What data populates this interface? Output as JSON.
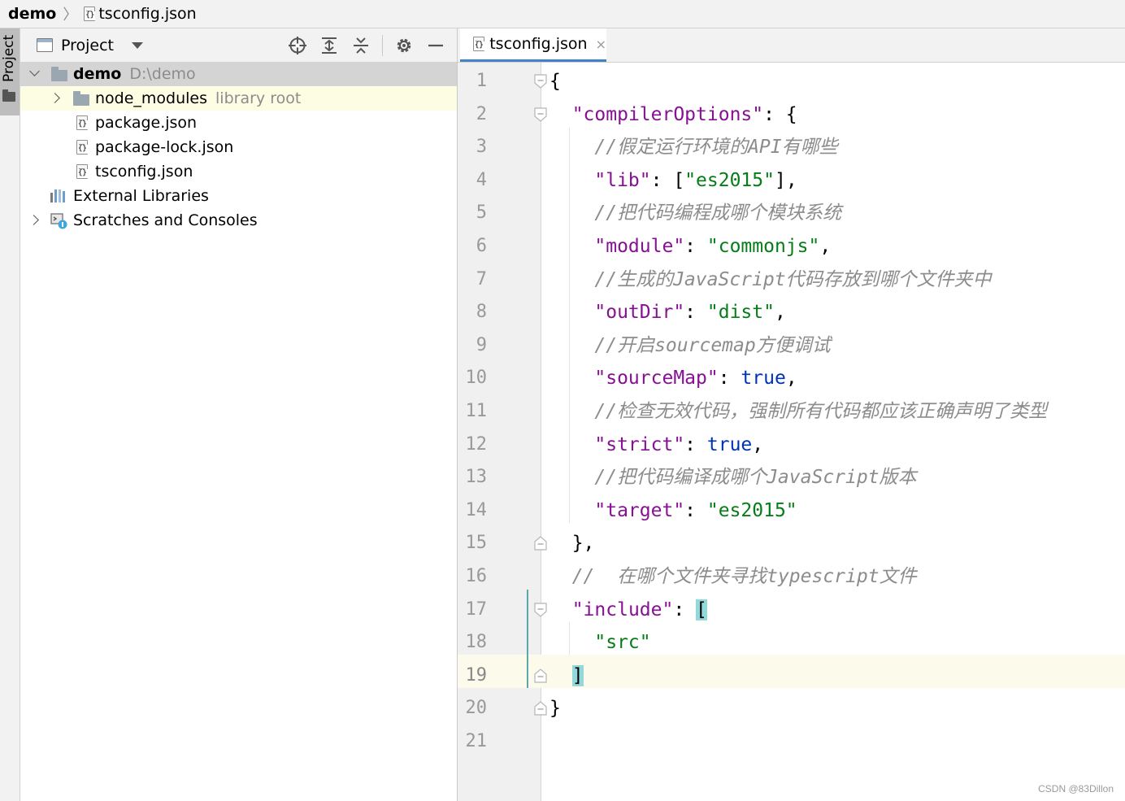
{
  "breadcrumb": {
    "root": "demo",
    "file": "tsconfig.json"
  },
  "toolstrip": {
    "project_tab_label": "Project"
  },
  "project_panel": {
    "title": "Project",
    "tools": [
      "locate-icon",
      "expand-all-icon",
      "collapse-all-icon",
      "gear-icon",
      "minimize-icon"
    ],
    "tree": [
      {
        "name": "demo",
        "path": "D:\\demo",
        "icon": "folder-icon",
        "expanded": true,
        "selected": true
      },
      {
        "name": "node_modules",
        "hint": "library root",
        "icon": "folder-icon",
        "expanded": false,
        "highlighted": true
      },
      {
        "name": "package.json",
        "icon": "json-file-icon"
      },
      {
        "name": "package-lock.json",
        "icon": "json-file-icon"
      },
      {
        "name": "tsconfig.json",
        "icon": "json-file-icon"
      },
      {
        "name": "External Libraries",
        "icon": "library-icon"
      },
      {
        "name": "Scratches and Consoles",
        "icon": "scratch-icon",
        "expanded": false
      }
    ]
  },
  "editor": {
    "tab": {
      "title": "tsconfig.json",
      "close": "×"
    },
    "current_line": 19,
    "lines": [
      {
        "n": "1",
        "tokens": [
          [
            "p",
            "{"
          ]
        ]
      },
      {
        "n": "2",
        "tokens": [
          [
            "p",
            "  "
          ],
          [
            "key",
            "\"compilerOptions\""
          ],
          [
            "p",
            ": {"
          ]
        ]
      },
      {
        "n": "3",
        "tokens": [
          [
            "p",
            "    "
          ],
          [
            "cm",
            "//假定运行环境的API有哪些"
          ]
        ]
      },
      {
        "n": "4",
        "tokens": [
          [
            "p",
            "    "
          ],
          [
            "key",
            "\"lib\""
          ],
          [
            "p",
            ": ["
          ],
          [
            "str",
            "\"es2015\""
          ],
          [
            "p",
            "],"
          ]
        ]
      },
      {
        "n": "5",
        "tokens": [
          [
            "p",
            "    "
          ],
          [
            "cm",
            "//把代码编程成哪个模块系统"
          ]
        ]
      },
      {
        "n": "6",
        "tokens": [
          [
            "p",
            "    "
          ],
          [
            "key",
            "\"module\""
          ],
          [
            "p",
            ": "
          ],
          [
            "str",
            "\"commonjs\""
          ],
          [
            "p",
            ","
          ]
        ]
      },
      {
        "n": "7",
        "tokens": [
          [
            "p",
            "    "
          ],
          [
            "cm",
            "//生成的JavaScript代码存放到哪个文件夹中"
          ]
        ]
      },
      {
        "n": "8",
        "tokens": [
          [
            "p",
            "    "
          ],
          [
            "key",
            "\"outDir\""
          ],
          [
            "p",
            ": "
          ],
          [
            "str",
            "\"dist\""
          ],
          [
            "p",
            ","
          ]
        ]
      },
      {
        "n": "9",
        "tokens": [
          [
            "p",
            "    "
          ],
          [
            "cm",
            "//开启sourcemap方便调试"
          ]
        ]
      },
      {
        "n": "10",
        "tokens": [
          [
            "p",
            "    "
          ],
          [
            "key",
            "\"sourceMap\""
          ],
          [
            "p",
            ": "
          ],
          [
            "kw",
            "true"
          ],
          [
            "p",
            ","
          ]
        ]
      },
      {
        "n": "11",
        "tokens": [
          [
            "p",
            "    "
          ],
          [
            "cm",
            "//检查无效代码，强制所有代码都应该正确声明了类型"
          ]
        ]
      },
      {
        "n": "12",
        "tokens": [
          [
            "p",
            "    "
          ],
          [
            "key",
            "\"strict\""
          ],
          [
            "p",
            ": "
          ],
          [
            "kw",
            "true"
          ],
          [
            "p",
            ","
          ]
        ]
      },
      {
        "n": "13",
        "tokens": [
          [
            "p",
            "    "
          ],
          [
            "cm",
            "//把代码编译成哪个JavaScript版本"
          ]
        ]
      },
      {
        "n": "14",
        "tokens": [
          [
            "p",
            "    "
          ],
          [
            "key",
            "\"target\""
          ],
          [
            "p",
            ": "
          ],
          [
            "str",
            "\"es2015\""
          ]
        ]
      },
      {
        "n": "15",
        "tokens": [
          [
            "p",
            "  },"
          ]
        ]
      },
      {
        "n": "16",
        "tokens": [
          [
            "p",
            "  "
          ],
          [
            "cm",
            "//  在哪个文件夹寻找typescript文件"
          ]
        ]
      },
      {
        "n": "17",
        "tokens": [
          [
            "p",
            "  "
          ],
          [
            "key",
            "\"include\""
          ],
          [
            "p",
            ": "
          ],
          [
            "brk",
            "["
          ]
        ]
      },
      {
        "n": "18",
        "tokens": [
          [
            "p",
            "    "
          ],
          [
            "str",
            "\"src\""
          ]
        ]
      },
      {
        "n": "19",
        "tokens": [
          [
            "p",
            "  "
          ],
          [
            "brk",
            "]"
          ]
        ]
      },
      {
        "n": "20",
        "tokens": [
          [
            "p",
            "}"
          ]
        ]
      },
      {
        "n": "21",
        "tokens": []
      }
    ],
    "fold_markers": [
      {
        "line": 1,
        "kind": "open"
      },
      {
        "line": 2,
        "kind": "open"
      },
      {
        "line": 15,
        "kind": "close"
      },
      {
        "line": 17,
        "kind": "open"
      },
      {
        "line": 19,
        "kind": "close"
      },
      {
        "line": 20,
        "kind": "close"
      }
    ]
  },
  "watermark": "CSDN @83Dillon",
  "colors": {
    "json_key": "#871094",
    "json_string": "#067d17",
    "keyword": "#0033b3",
    "comment": "#8c8c8c",
    "brace_match": "#93d9d9",
    "current_line": "#fcfbeb",
    "selection_row": "#d4d4d4",
    "library_root_row": "#fdfde3"
  }
}
